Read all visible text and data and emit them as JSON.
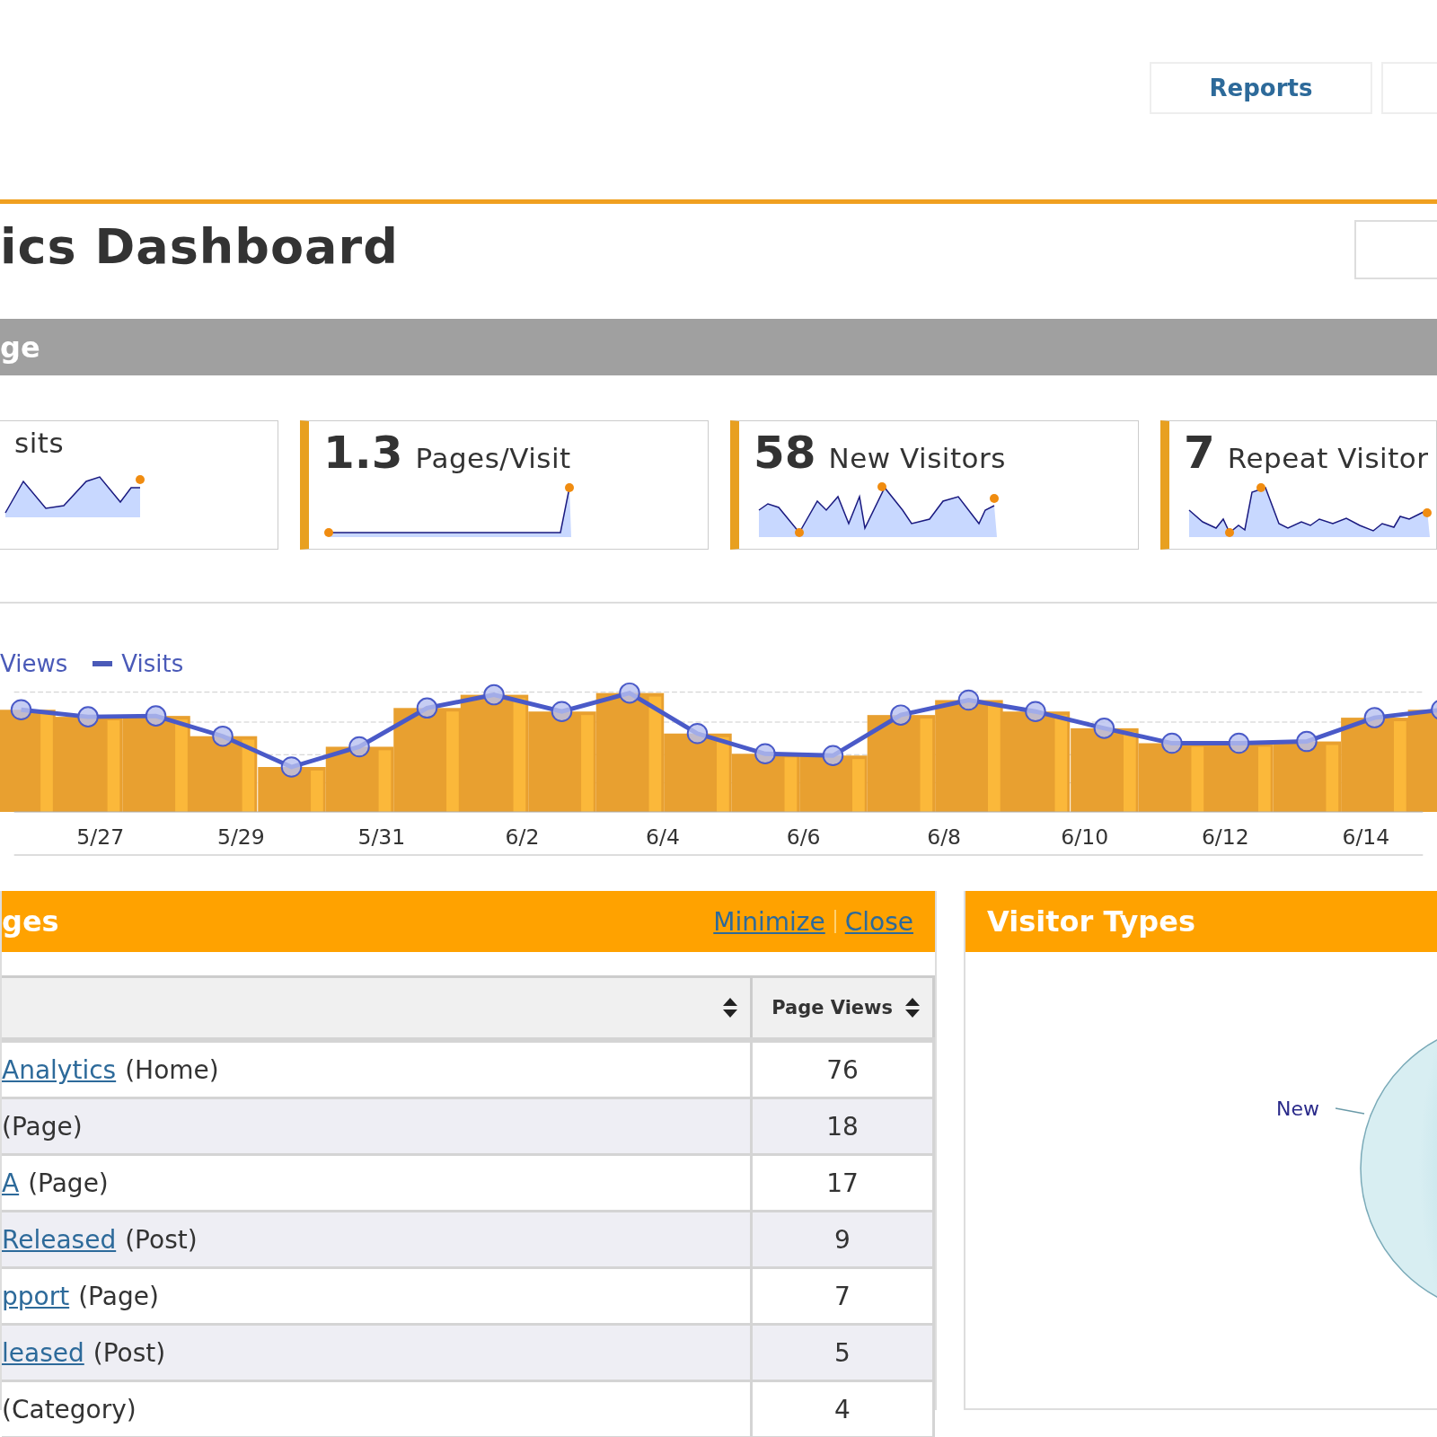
{
  "nav_buttons": [
    "Reports"
  ],
  "page_title": "ics Dashboard",
  "section_bar": {
    "title": "ge"
  },
  "stats": [
    {
      "label": "sits"
    },
    {
      "value": "1.3",
      "label": "Pages/Visit"
    },
    {
      "value": "58",
      "label": "New Visitors"
    },
    {
      "value": "7",
      "label": "Repeat Visitor"
    }
  ],
  "trend_chart": {
    "legend": [
      {
        "label": "Views",
        "kind": "bars"
      },
      {
        "label": "Visits",
        "kind": "line"
      }
    ],
    "x_labels": [
      "5/27",
      "5/29",
      "5/31",
      "6/2",
      "6/4",
      "6/6",
      "6/8",
      "6/10",
      "6/12",
      "6/14"
    ]
  },
  "pages_panel": {
    "title": "ges",
    "actions": [
      "Minimize",
      "Close"
    ],
    "columns": [
      {
        "kind": "sort_only"
      },
      {
        "kind": "labeled",
        "label": "Page Views"
      }
    ],
    "rows": [
      {
        "link": "Analytics",
        "type": "(Home)",
        "views": "76"
      },
      {
        "type": "(Page)",
        "views": "18"
      },
      {
        "link": "A",
        "type": "(Page)",
        "views": "17"
      },
      {
        "link": "Released",
        "type": "(Post)",
        "views": "9"
      },
      {
        "link": "pport",
        "type": "(Page)",
        "views": "7"
      },
      {
        "link": "leased",
        "type": "(Post)",
        "views": "5"
      },
      {
        "type": "(Category)",
        "views": "4"
      }
    ]
  },
  "visitor_panel": {
    "title": "Visitor Types",
    "pie_labels": [
      "New"
    ]
  }
}
